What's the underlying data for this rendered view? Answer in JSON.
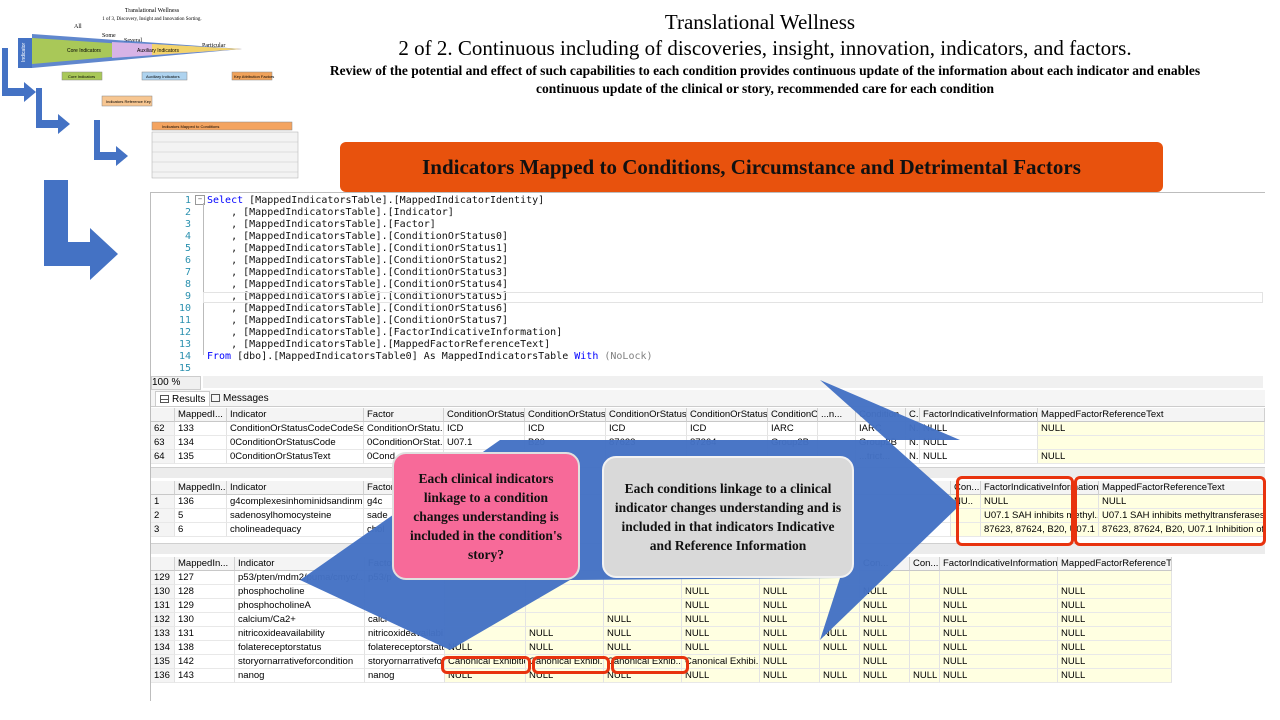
{
  "header": {
    "title": "Translational Wellness",
    "subtitle": "2 of  2. Continuous including of discoveries, insight, innovation, indicators, and factors.",
    "description": "Review of the potential  and  effect of such capabilities to each condition  provides  continuous  update of the information  about each indicator  and enables continuous  update of the clinical  or story, recommended  care for each condition"
  },
  "banner": {
    "text": "Indicators Mapped to Conditions, Circumstance and Detrimental Factors"
  },
  "thumbnail": {
    "title": "Translational Wellness",
    "subtitle": "1 of 3, Discovery, Insight and Innovation Sorting.",
    "labels": [
      "All",
      "Some",
      "Several",
      "Particular",
      "Indicator",
      "Core Indicators",
      "Auxiliary Indicators",
      "Core Indicators",
      "Auxiliary Indicators",
      "Key Attribution Factors",
      "Indicators Reference Key",
      "Indicators Mapped to Conditions"
    ]
  },
  "editor": {
    "zoom": "100 %",
    "lines": [
      {
        "n": "1",
        "kw": "Select ",
        "text": "[MappedIndicatorsTable].[MappedIndicatorIdentity]"
      },
      {
        "n": "2",
        "kw": "",
        "text": "    , [MappedIndicatorsTable].[Indicator]"
      },
      {
        "n": "3",
        "kw": "",
        "text": "    , [MappedIndicatorsTable].[Factor]"
      },
      {
        "n": "4",
        "kw": "",
        "text": "    , [MappedIndicatorsTable].[ConditionOrStatus0]"
      },
      {
        "n": "5",
        "kw": "",
        "text": "    , [MappedIndicatorsTable].[ConditionOrStatus1]"
      },
      {
        "n": "6",
        "kw": "",
        "text": "    , [MappedIndicatorsTable].[ConditionOrStatus2]"
      },
      {
        "n": "7",
        "kw": "",
        "text": "    , [MappedIndicatorsTable].[ConditionOrStatus3]"
      },
      {
        "n": "8",
        "kw": "",
        "text": "    , [MappedIndicatorsTable].[ConditionOrStatus4]"
      },
      {
        "n": "9",
        "kw": "",
        "text": "    , [MappedIndicatorsTable].[ConditionOrStatus5]"
      },
      {
        "n": "10",
        "kw": "",
        "text": "    , [MappedIndicatorsTable].[ConditionOrStatus6]"
      },
      {
        "n": "11",
        "kw": "",
        "text": "    , [MappedIndicatorsTable].[ConditionOrStatus7]"
      },
      {
        "n": "12",
        "kw": "",
        "text": "    , [MappedIndicatorsTable].[FactorIndicativeInformation]"
      },
      {
        "n": "13",
        "kw": "",
        "text": "    , [MappedIndicatorsTable].[MappedFactorReferenceText]"
      },
      {
        "n": "14",
        "kw": "From ",
        "text": "[dbo].[MappedIndicatorsTable0] As MappedIndicatorsTable ",
        "kw2": "With ",
        "tail": "(NoLock)"
      },
      {
        "n": "15",
        "kw": "",
        "text": ""
      }
    ]
  },
  "tabs": {
    "results": "Results",
    "messages": "Messages"
  },
  "grid1": {
    "headers": [
      "",
      "MappedI...",
      "Indicator",
      "Factor",
      "ConditionOrStatus0",
      "ConditionOrStatus1",
      "ConditionOrStatus2",
      "ConditionOrStatus3",
      "ConditionO...",
      "...n...",
      "Condition...",
      "C...",
      "FactorIndicativeInformation",
      "MappedFactorReferenceText"
    ],
    "rows": [
      [
        "62",
        "133",
        "ConditionOrStatusCodeCodeSet",
        "ConditionOrStatu...",
        "ICD",
        "ICD",
        "ICD",
        "ICD",
        "IARC",
        "",
        "IARC",
        "N.",
        "NULL",
        "NULL"
      ],
      [
        "63",
        "134",
        "0ConditionOrStatusCode",
        "0ConditionOrStat...",
        "U07.1",
        "B20",
        "87623",
        "87264",
        "Group2B",
        "",
        "Group2B",
        "N.",
        "NULL",
        ""
      ],
      [
        "64",
        "135",
        "0ConditionOrStatusText",
        "0Cond",
        "",
        "",
        "",
        "",
        "",
        "",
        "...trict...",
        "N.",
        "NULL",
        "NULL"
      ]
    ]
  },
  "grid2": {
    "headers": [
      "",
      "MappedIn...",
      "Indicator",
      "Factor",
      "Con...",
      "FactorIndicativeInformation",
      "MappedFactorReferenceText"
    ],
    "rows": [
      [
        "1",
        "136",
        "g4complexesinhominidsandinmicr...",
        "g4c",
        "NU..",
        "NULL",
        "NULL"
      ],
      [
        "2",
        "5",
        "sadenosylhomocysteine",
        "sade",
        "",
        "U07.1   SAH inhibits methyl...",
        "U07.1   SAH inhibits methyltransferases which asso"
      ],
      [
        "3",
        "6",
        "cholineadequacy",
        "chol",
        "",
        "87623, 87624, B20, U07.1 ...",
        "87623, 87624, B20, U07.1 Inhibition of PEMT by r"
      ]
    ]
  },
  "grid3": {
    "headers": [
      "",
      "MappedIn...",
      "Indicator",
      "Factor",
      "",
      "",
      "",
      "",
      "",
      "",
      "Con...",
      "Con...",
      "FactorIndicativeInformation",
      "MappedFactorReferenceText"
    ],
    "rows": [
      [
        "129",
        "127",
        "p53/pten/mdm2/puma/cmyc/...",
        "p53/p",
        "",
        "",
        "",
        "",
        "",
        "",
        "",
        "",
        "",
        ""
      ],
      [
        "130",
        "128",
        "phosphocholine",
        "",
        "",
        "",
        "",
        "NULL",
        "NULL",
        "",
        "NULL",
        "",
        "NULL",
        "NULL"
      ],
      [
        "131",
        "129",
        "phosphocholineA",
        "",
        "",
        "",
        "",
        "NULL",
        "NULL",
        "",
        "NULL",
        "",
        "NULL",
        "NULL"
      ],
      [
        "132",
        "130",
        "calcium/Ca2+",
        "calci",
        "",
        "",
        "NULL",
        "NULL",
        "NULL",
        "",
        "NULL",
        "",
        "NULL",
        "NULL"
      ],
      [
        "133",
        "131",
        "nitricoxideavailability",
        "nitricoxideavailabi...",
        "",
        "NULL",
        "NULL",
        "NULL",
        "NULL",
        "NULL",
        "NULL",
        "",
        "NULL",
        "NULL"
      ],
      [
        "134",
        "138",
        "folatereceptorstatus",
        "folatereceptorstatus",
        "NULL",
        "NULL",
        "NULL",
        "NULL",
        "NULL",
        "NULL",
        "NULL",
        "",
        "NULL",
        "NULL"
      ],
      [
        "135",
        "142",
        "storyornarrativeforcondition",
        "storyornarrativefor...",
        "Canonical Exhibition...",
        "Canonical Exhibi...",
        "Canonical Exhib...",
        "Canonical Exhibi...",
        "NULL",
        "",
        "NULL",
        "",
        "NULL",
        "NULL"
      ],
      [
        "136",
        "143",
        "nanog",
        "nanog",
        "NULL",
        "NULL",
        "NULL",
        "NULL",
        "NULL",
        "NULL",
        "NULL",
        "NULL",
        "NULL",
        "NULL"
      ]
    ]
  },
  "callouts": {
    "pink": "Each clinical indicators linkage to a condition  changes understanding  is included  in the condition's  story?",
    "gray": "Each conditions linkage to a clinical indicator  changes understanding  and is included in that indicators  Indicative  and Reference Information"
  },
  "colors": {
    "banner": "#e8520d",
    "arrow": "#4472c4",
    "callout_pink": "#f76a99",
    "callout_gray": "#d9d9d9",
    "highlight": "#e8330e"
  }
}
